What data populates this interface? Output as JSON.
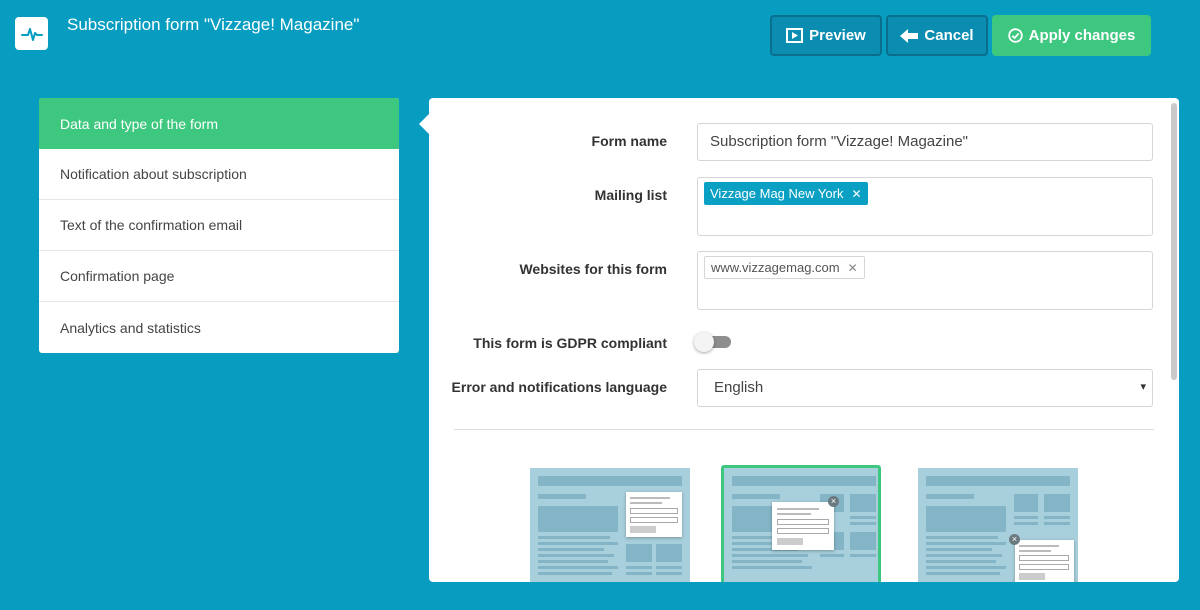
{
  "header": {
    "title": "Subscription form \"Vizzage! Magazine\"",
    "preview_label": "Preview",
    "cancel_label": "Cancel",
    "apply_label": "Apply changes"
  },
  "sidebar": {
    "items": [
      {
        "label": "Data and type of the form",
        "active": true
      },
      {
        "label": "Notification about subscription"
      },
      {
        "label": "Text of the confirmation email"
      },
      {
        "label": "Confirmation page"
      },
      {
        "label": "Analytics and statistics"
      }
    ]
  },
  "form": {
    "form_name_label": "Form name",
    "form_name_value": "Subscription form \"Vizzage! Magazine\"",
    "mailing_list_label": "Mailing list",
    "mailing_list_tags": [
      "Vizzage Mag New York"
    ],
    "websites_label": "Websites for this form",
    "websites_tags": [
      "www.vizzagemag.com"
    ],
    "gdpr_label": "This form is GDPR compliant",
    "gdpr_enabled": false,
    "language_label": "Error and notifications language",
    "language_value": "English"
  },
  "layouts": {
    "options": [
      "side-popup",
      "center-popup",
      "corner-popup"
    ],
    "selected": "center-popup"
  },
  "colors": {
    "background": "#069dc1",
    "accent_green": "#3ec77e",
    "tag_blue": "#0aa0c3"
  },
  "tag_remove_glyph": "✕",
  "select_caret_glyph": "▾"
}
